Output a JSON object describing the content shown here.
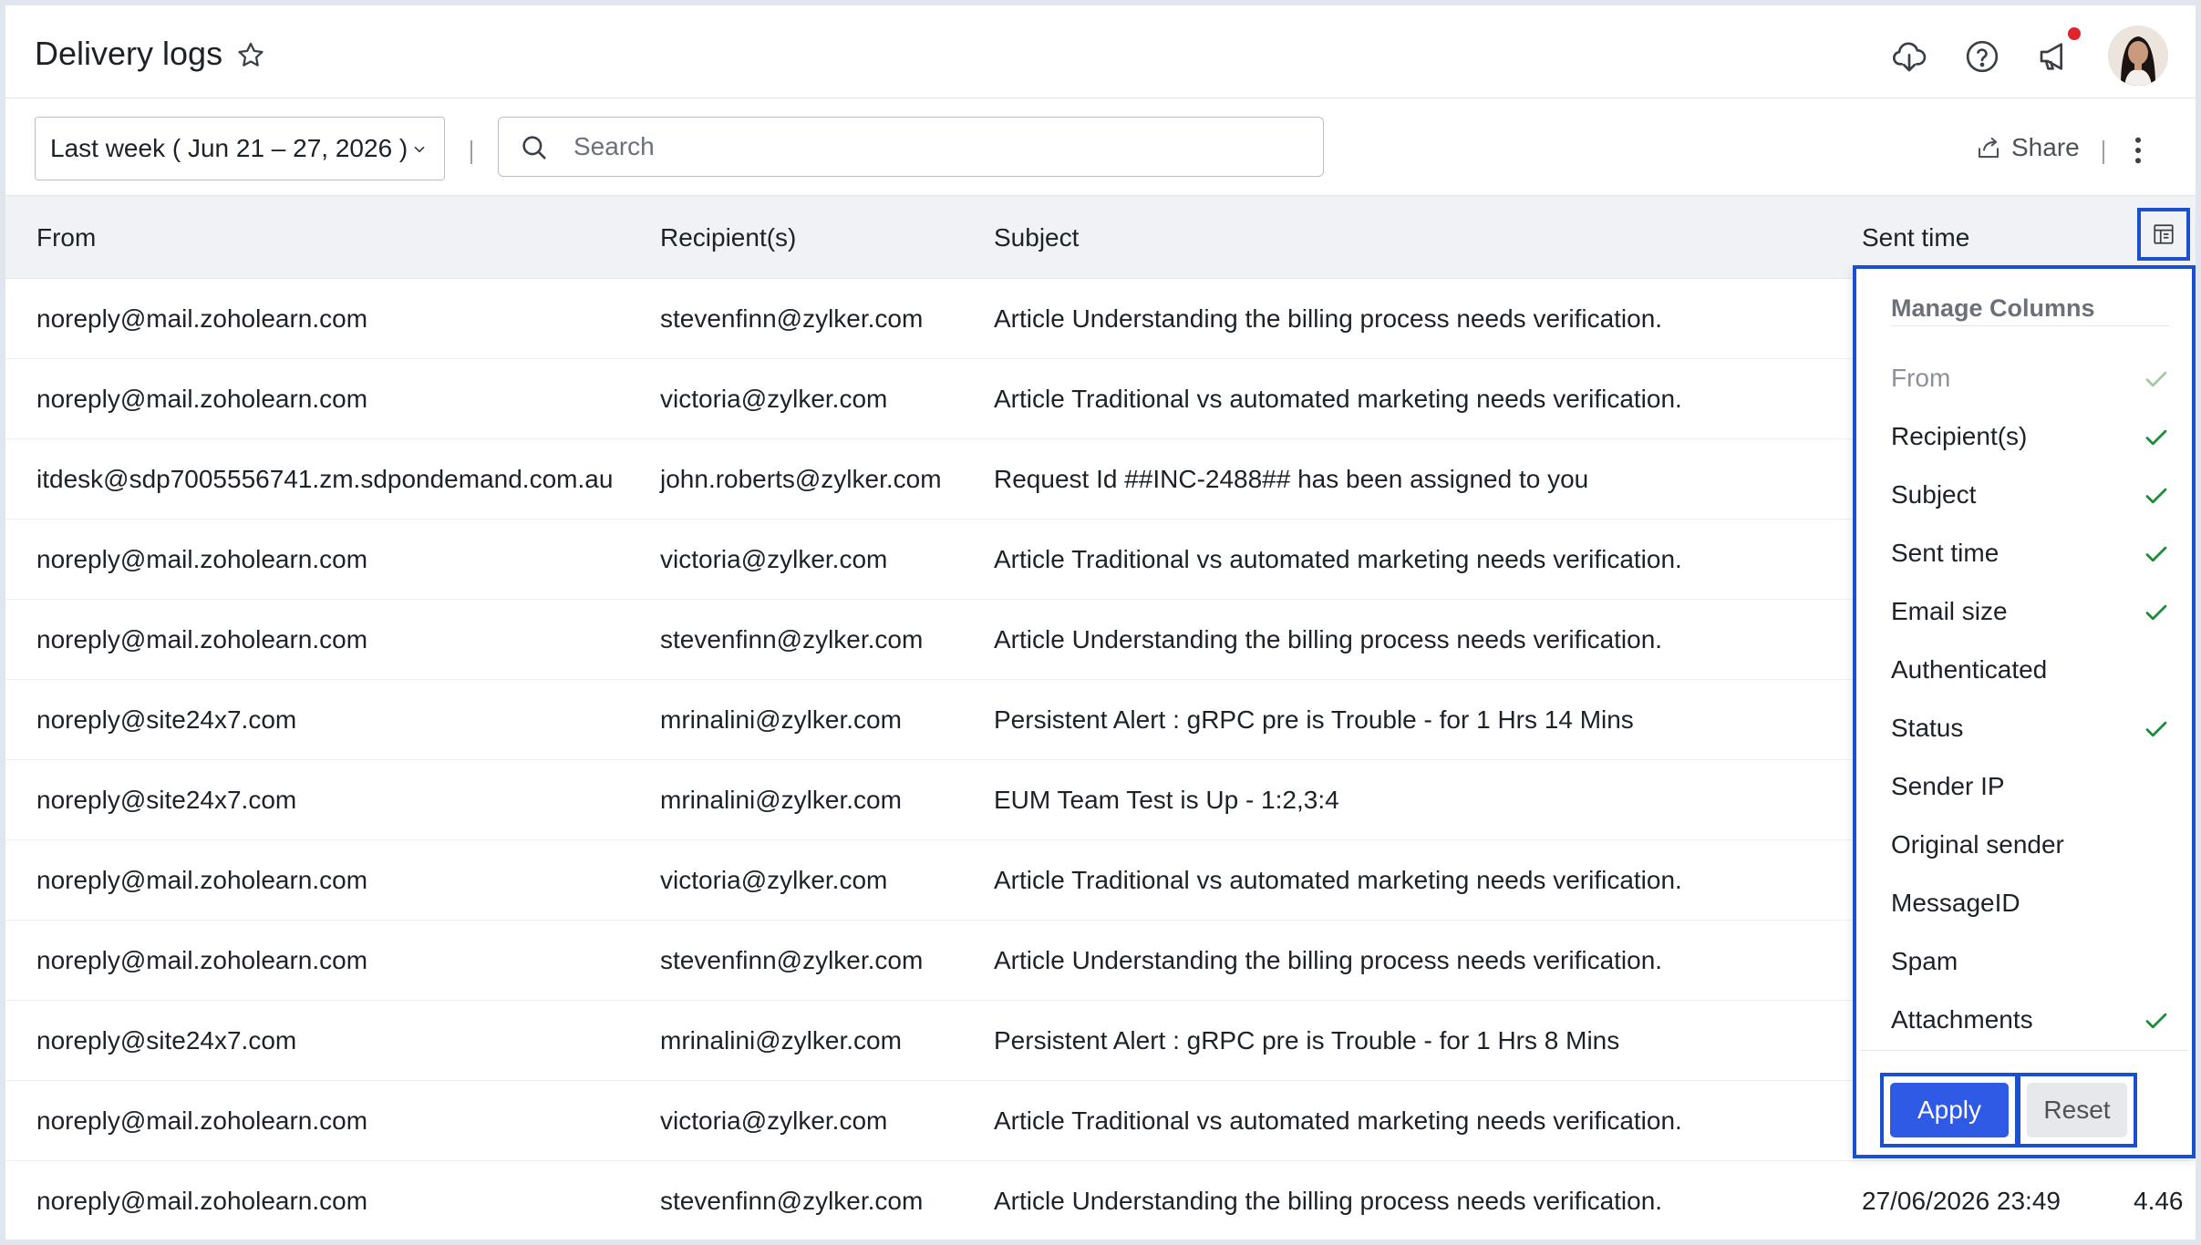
{
  "header": {
    "title": "Delivery logs",
    "icons": [
      "star-outline-icon",
      "cloud-download-icon",
      "help-icon",
      "announcement-icon",
      "avatar"
    ]
  },
  "toolbar": {
    "date_range": "Last week ( Jun 21 – 27, 2026 )",
    "search_placeholder": "Search",
    "share_label": "Share"
  },
  "table": {
    "columns": [
      "From",
      "Recipient(s)",
      "Subject",
      "Sent time"
    ],
    "rows": [
      {
        "from": "noreply@mail.zoholearn.com",
        "recipient": "stevenfinn@zylker.com",
        "subject": "Article Understanding the billing process needs verification.",
        "sent_time": "",
        "size": ""
      },
      {
        "from": "noreply@mail.zoholearn.com",
        "recipient": "victoria@zylker.com",
        "subject": "Article Traditional vs automated marketing needs verification.",
        "sent_time": "",
        "size": ""
      },
      {
        "from": "itdesk@sdp7005556741.zm.sdpondemand.com.au",
        "recipient": "john.roberts@zylker.com",
        "subject": "Request Id ##INC-2488## has been assigned to you",
        "sent_time": "",
        "size": ""
      },
      {
        "from": "noreply@mail.zoholearn.com",
        "recipient": "victoria@zylker.com",
        "subject": "Article Traditional vs automated marketing needs verification.",
        "sent_time": "",
        "size": ""
      },
      {
        "from": "noreply@mail.zoholearn.com",
        "recipient": "stevenfinn@zylker.com",
        "subject": "Article Understanding the billing process needs verification.",
        "sent_time": "",
        "size": ""
      },
      {
        "from": "noreply@site24x7.com",
        "recipient": "mrinalini@zylker.com",
        "subject": "Persistent Alert : gRPC pre is Trouble - for 1 Hrs 14 Mins",
        "sent_time": "",
        "size": ""
      },
      {
        "from": "noreply@site24x7.com",
        "recipient": "mrinalini@zylker.com",
        "subject": "EUM Team Test is Up - 1:2,3:4",
        "sent_time": "",
        "size": ""
      },
      {
        "from": "noreply@mail.zoholearn.com",
        "recipient": "victoria@zylker.com",
        "subject": "Article Traditional vs automated marketing needs verification.",
        "sent_time": "",
        "size": ""
      },
      {
        "from": "noreply@mail.zoholearn.com",
        "recipient": "stevenfinn@zylker.com",
        "subject": "Article Understanding the billing process needs verification.",
        "sent_time": "",
        "size": ""
      },
      {
        "from": "noreply@site24x7.com",
        "recipient": "mrinalini@zylker.com",
        "subject": "Persistent Alert : gRPC pre is Trouble - for 1 Hrs 8 Mins",
        "sent_time": "",
        "size": ""
      },
      {
        "from": "noreply@mail.zoholearn.com",
        "recipient": "victoria@zylker.com",
        "subject": "Article Traditional vs automated marketing needs verification.",
        "sent_time": "",
        "size": ""
      },
      {
        "from": "noreply@mail.zoholearn.com",
        "recipient": "stevenfinn@zylker.com",
        "subject": "Article Understanding the billing process needs verification.",
        "sent_time": "27/06/2026 23:49",
        "size": "4.46"
      }
    ]
  },
  "manage_columns": {
    "title": "Manage Columns",
    "options": [
      {
        "label": "From",
        "checked": true,
        "disabled": true
      },
      {
        "label": "Recipient(s)",
        "checked": true,
        "disabled": false
      },
      {
        "label": "Subject",
        "checked": true,
        "disabled": false
      },
      {
        "label": "Sent time",
        "checked": true,
        "disabled": false
      },
      {
        "label": "Email size",
        "checked": true,
        "disabled": false
      },
      {
        "label": "Authenticated",
        "checked": false,
        "disabled": false
      },
      {
        "label": "Status",
        "checked": true,
        "disabled": false
      },
      {
        "label": "Sender IP",
        "checked": false,
        "disabled": false
      },
      {
        "label": "Original sender",
        "checked": false,
        "disabled": false
      },
      {
        "label": "MessageID",
        "checked": false,
        "disabled": false
      },
      {
        "label": "Spam",
        "checked": false,
        "disabled": false
      },
      {
        "label": "Attachments",
        "checked": true,
        "disabled": false
      }
    ],
    "apply_label": "Apply",
    "reset_label": "Reset"
  },
  "colors": {
    "accent": "#2e5ae6",
    "highlight": "#1a4fd0",
    "check": "#1e8a3c",
    "check_disabled": "#9fc9a9",
    "notification": "#e0242b"
  }
}
